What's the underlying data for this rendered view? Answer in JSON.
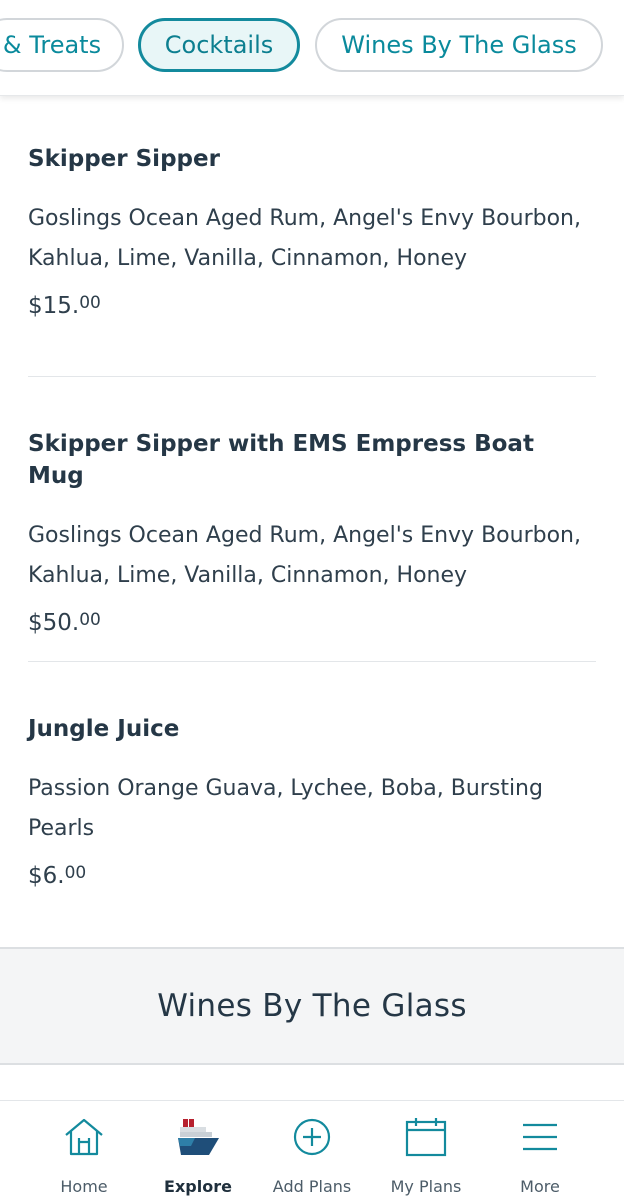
{
  "tabs": [
    {
      "label": "& Treats",
      "active": false
    },
    {
      "label": "Cocktails",
      "active": true
    },
    {
      "label": "Wines By The Glass",
      "active": false
    }
  ],
  "menu_items": [
    {
      "name": "Skipper Sipper",
      "description": "Goslings Ocean Aged Rum, Angel's Envy Bourbon, Kahlua, Lime, Vanilla, Cinnamon, Honey",
      "price_dollars": "$15.",
      "price_cents": "00"
    },
    {
      "name": "Skipper Sipper with EMS Empress Boat Mug",
      "description": "Goslings Ocean Aged Rum, Angel's Envy Bourbon, Kahlua, Lime, Vanilla, Cinnamon, Honey",
      "price_dollars": "$50.",
      "price_cents": "00"
    },
    {
      "name": "Jungle Juice",
      "description": "Passion Orange Guava, Lychee, Boba, Bursting Pearls",
      "price_dollars": "$6.",
      "price_cents": "00"
    }
  ],
  "section_header": "Wines By The Glass",
  "bottom_nav": [
    {
      "label": "Home",
      "icon": "home-icon",
      "active": false
    },
    {
      "label": "Explore",
      "icon": "ship-icon",
      "active": true
    },
    {
      "label": "Add Plans",
      "icon": "plus-circle-icon",
      "active": false
    },
    {
      "label": "My Plans",
      "icon": "calendar-icon",
      "active": false
    },
    {
      "label": "More",
      "icon": "menu-icon",
      "active": false
    }
  ],
  "colors": {
    "accent": "#138a9d",
    "text": "#253746",
    "section_bg": "#f4f5f6"
  }
}
